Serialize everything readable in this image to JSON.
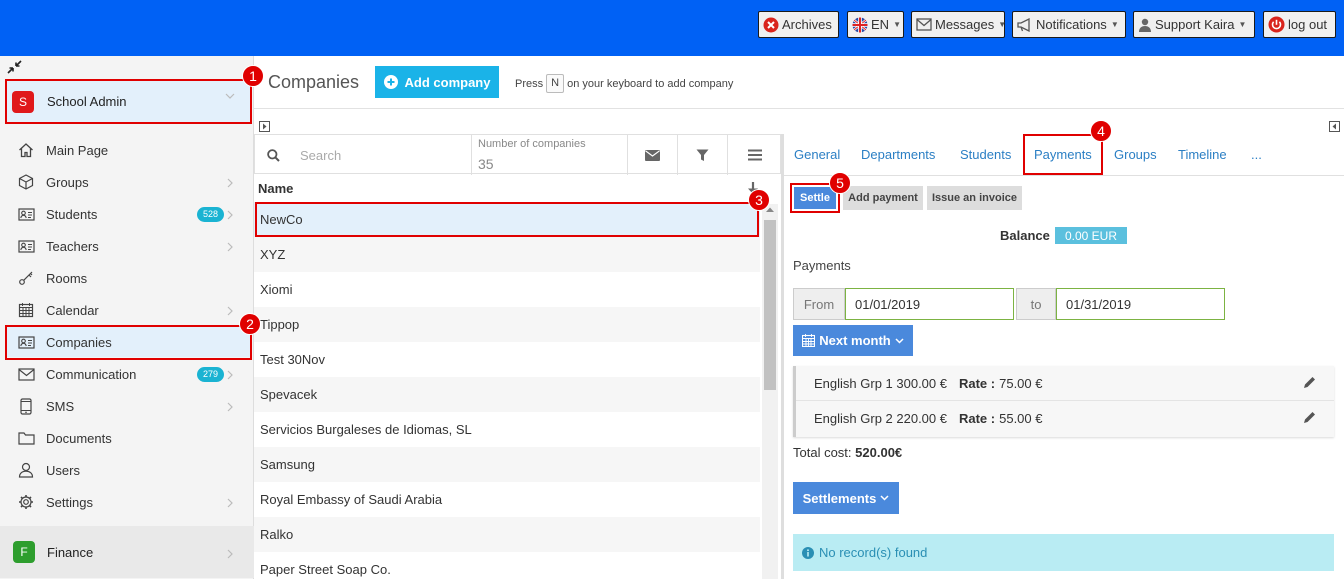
{
  "topbar": {
    "color": "#0061f5",
    "archives": "Archives",
    "language": "EN",
    "messages": "Messages",
    "notifications": "Notifications",
    "user": "Support Kaira",
    "logout": "log out"
  },
  "sidebar": {
    "account": {
      "letter": "S",
      "label": "School Admin",
      "color": "#e0191b"
    },
    "items": [
      {
        "label": "Main Page",
        "icon": "home-icon"
      },
      {
        "label": "Groups",
        "icon": "cube-icon"
      },
      {
        "label": "Students",
        "icon": "id-card-icon",
        "count": "528"
      },
      {
        "label": "Teachers",
        "icon": "id-card-icon"
      },
      {
        "label": "Rooms",
        "icon": "key-icon"
      },
      {
        "label": "Calendar",
        "icon": "calendar-icon"
      },
      {
        "label": "Companies",
        "icon": "id-card-icon"
      },
      {
        "label": "Communication",
        "icon": "envelope-icon",
        "count": "279"
      },
      {
        "label": "SMS",
        "icon": "phone-icon"
      },
      {
        "label": "Documents",
        "icon": "folder-icon"
      },
      {
        "label": "Users",
        "icon": "user-icon"
      },
      {
        "label": "Settings",
        "icon": "gear-icon"
      }
    ],
    "finance": {
      "letter": "F",
      "label": "Finance",
      "color": "#2e9e2e"
    }
  },
  "annotations": [
    "1",
    "2",
    "3",
    "4",
    "5"
  ],
  "header": {
    "title": "Companies",
    "add_button": "Add company",
    "hint_press": "Press",
    "hint_key": "N",
    "hint_rest": "on your keyboard to add company"
  },
  "list": {
    "search_placeholder": "Search",
    "count_label": "Number of companies",
    "count_value": "35",
    "column_name": "Name",
    "rows": [
      "NewCo",
      "XYZ",
      "Xiomi",
      "Tippop",
      "Test 30Nov",
      "Spevacek",
      "Servicios Burgaleses de Idiomas, SL",
      "Samsung",
      "Royal Embassy of Saudi Arabia",
      "Ralko",
      "Paper Street Soap Co."
    ]
  },
  "detail": {
    "tabs": [
      "General",
      "Departments",
      "Students",
      "Payments",
      "Groups",
      "Timeline",
      "..."
    ],
    "settle": "Settle",
    "add_payment": "Add payment",
    "issue_invoice": "Issue an invoice",
    "balance_label": "Balance",
    "balance_value": "0.00 EUR",
    "payments_label": "Payments",
    "from_label": "From",
    "from_value": "01/01/2019",
    "to_label": "to",
    "to_value": "01/31/2019",
    "next_month": "Next month",
    "payment_items": [
      {
        "group": "English Grp 1 300.00 €",
        "rate_label": "Rate :",
        "rate": "75.00 €"
      },
      {
        "group": "English Grp 2 220.00 €",
        "rate_label": "Rate :",
        "rate": "55.00 €"
      }
    ],
    "total_label": "Total cost:",
    "total_value": "520.00€",
    "settlements": "Settlements",
    "no_records": "No record(s) found"
  }
}
